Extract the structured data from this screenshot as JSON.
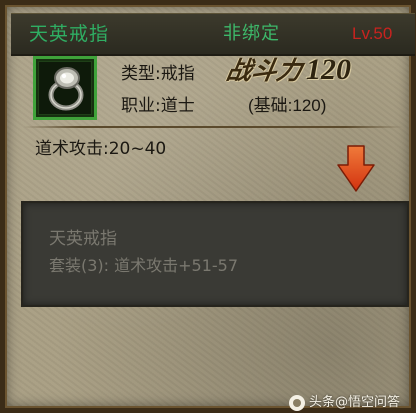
{
  "item": {
    "name": "天英戒指",
    "bind_status": "非绑定",
    "level": "Lv.50",
    "type_label": "类型:戒指",
    "class_label": "职业:道士",
    "power_label": "战斗力",
    "power_value": "120",
    "base_power": "(基础:120)",
    "attack": "道术攻击:20~40",
    "icon": "ring-icon"
  },
  "set": {
    "name": "天英戒指",
    "bonus": "套装(3): 道术攻击+51-57"
  },
  "indicator": {
    "icon": "down-arrow-icon",
    "color": "#e0461c"
  },
  "watermark": {
    "text": "头条@悟空问答"
  },
  "colors": {
    "name_green": "#2fae63",
    "level_red": "#c8231f",
    "slot_green": "#3fa23a"
  }
}
